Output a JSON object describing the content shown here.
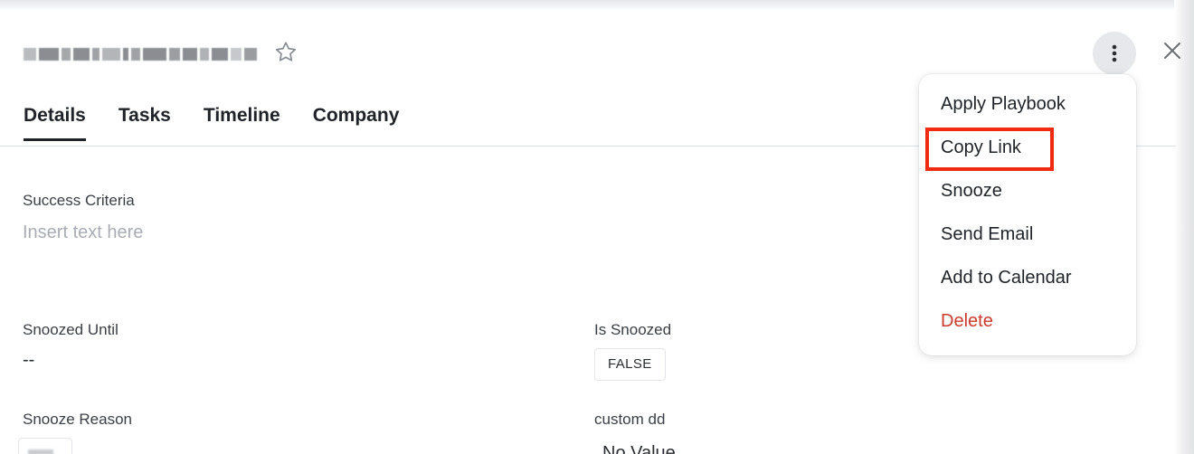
{
  "header": {
    "star_icon": "star-outline-icon",
    "more_icon": "kebab-vertical-icon",
    "close_icon": "close-icon"
  },
  "tabs": [
    {
      "label": "Details",
      "active": true
    },
    {
      "label": "Tasks",
      "active": false
    },
    {
      "label": "Timeline",
      "active": false
    },
    {
      "label": "Company",
      "active": false
    }
  ],
  "fields": {
    "success_criteria": {
      "label": "Success Criteria",
      "placeholder": "Insert text here"
    },
    "snoozed_until": {
      "label": "Snoozed Until",
      "value": "--"
    },
    "is_snoozed": {
      "label": "Is Snoozed",
      "value": "FALSE"
    },
    "snooze_reason": {
      "label": "Snooze Reason"
    },
    "custom_dd": {
      "label": "custom dd",
      "value": "No Value"
    }
  },
  "menu": {
    "items": [
      {
        "label": "Apply Playbook"
      },
      {
        "label": "Copy Link",
        "highlighted": true
      },
      {
        "label": "Snooze"
      },
      {
        "label": "Send Email"
      },
      {
        "label": "Add to Calendar"
      },
      {
        "label": "Delete",
        "danger": true
      }
    ]
  },
  "colors": {
    "highlight": "#f02b10",
    "danger": "#cc3b2e",
    "text": "#1f2328",
    "placeholder": "#a9adb3"
  }
}
